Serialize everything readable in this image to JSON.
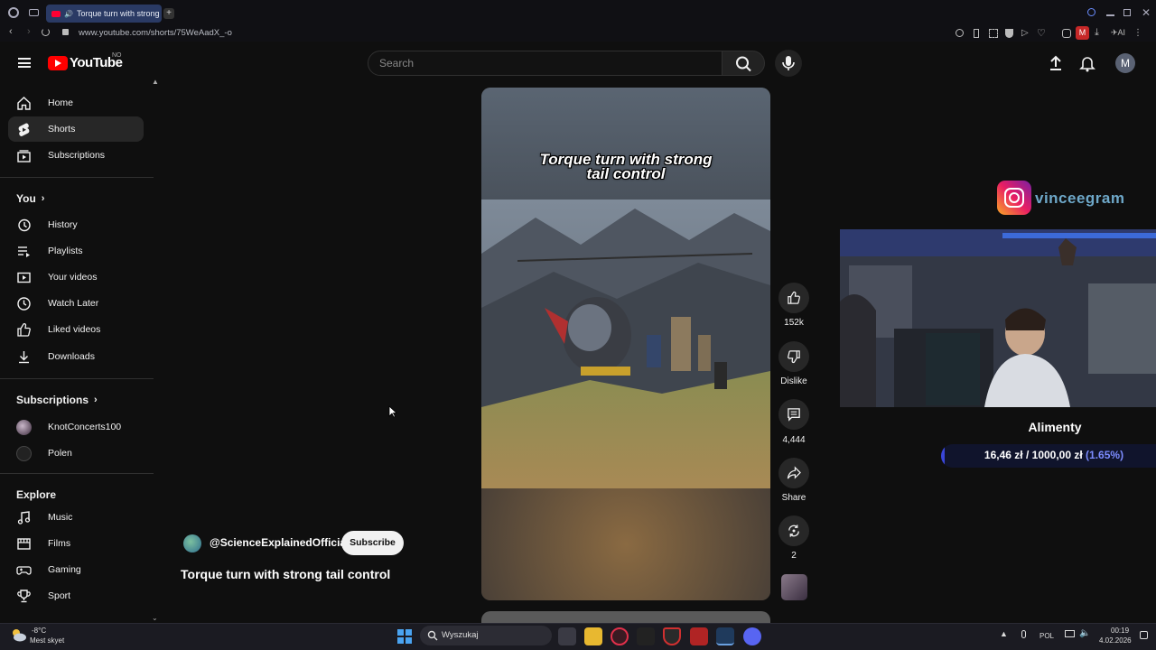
{
  "browser": {
    "tab_title": "Torque turn with stron​g",
    "url": "www.youtube.com/shorts/75WeAadX_-o",
    "profile_initial": "M"
  },
  "youtube": {
    "logo_text": "YouTube",
    "country_code": "NO",
    "search_placeholder": "Search",
    "avatar_initial": "M"
  },
  "sidebar": {
    "main": [
      {
        "label": "Home",
        "icon": "home-icon"
      },
      {
        "label": "Shorts",
        "icon": "shorts-icon",
        "active": true
      },
      {
        "label": "Subscriptions",
        "icon": "subscriptions-icon"
      }
    ],
    "you_heading": "You",
    "you_items": [
      {
        "label": "History",
        "icon": "history-icon"
      },
      {
        "label": "Playlists",
        "icon": "playlists-icon"
      },
      {
        "label": "Your videos",
        "icon": "your-videos-icon"
      },
      {
        "label": "Watch Later",
        "icon": "watch-later-icon"
      },
      {
        "label": "Liked videos",
        "icon": "liked-videos-icon"
      },
      {
        "label": "Downloads",
        "icon": "downloads-icon"
      }
    ],
    "subscriptions_heading": "Subscriptions",
    "subscriptions": [
      {
        "label": "KnotConcerts100"
      },
      {
        "label": "Polen"
      }
    ],
    "explore_heading": "Explore",
    "explore_items": [
      {
        "label": "Music",
        "icon": "music-icon"
      },
      {
        "label": "Films",
        "icon": "films-icon"
      },
      {
        "label": "Gaming",
        "icon": "gaming-icon"
      },
      {
        "label": "Sport",
        "icon": "sport-icon"
      }
    ]
  },
  "short": {
    "caption_line1": "Torque turn with strong",
    "caption_line2": "tail control",
    "channel": "@ScienceExplainedOfficial",
    "subscribe_label": "Subscribe",
    "title": "Torque turn with strong tail control",
    "likes": "152k",
    "dislike_label": "Dislike",
    "comments": "4,444",
    "share_label": "Share",
    "remix_count": "2"
  },
  "overlay": {
    "instagram_handle": "vinceegram",
    "goal_title": "Alimenty",
    "goal_current": "16,46 zł",
    "goal_separator": "/",
    "goal_target": "1000,00 zł",
    "goal_percent": "(1.65%)",
    "goal_fraction": 0.0165
  },
  "taskbar": {
    "weather_temp": "-8°C",
    "weather_desc": "Mest skyet",
    "search_label": "Wyszukaj",
    "language": "POL",
    "time": "00:19",
    "date": "4.02.2026"
  },
  "colors": {
    "youtube_red": "#ff0000",
    "tab_active": "#2a3a64",
    "goal_fill": "#3a46d8",
    "goal_percent": "#7c8cff"
  }
}
